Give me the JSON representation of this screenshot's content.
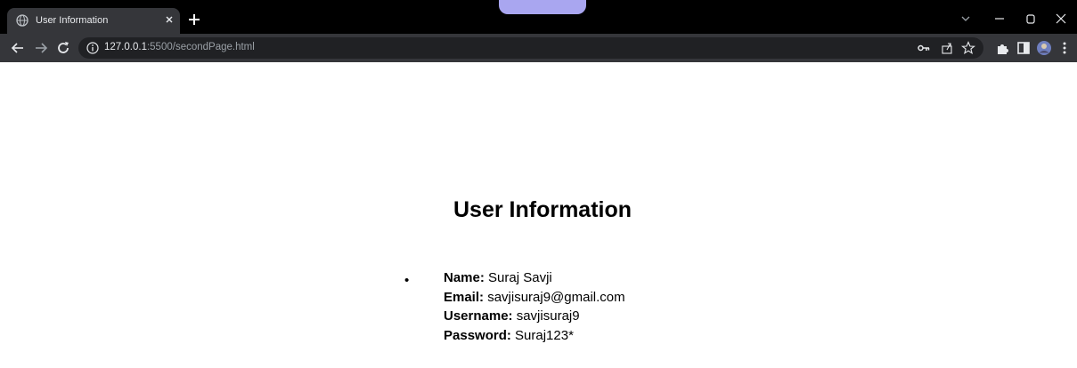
{
  "browser": {
    "tab": {
      "title": "User Information"
    },
    "address_bar": {
      "host": "127.0.0.1",
      "rest": ":5500/secondPage.html"
    },
    "accent_color": "#a9a6f0"
  },
  "page": {
    "title": "User Information",
    "user": [
      {
        "label": "Name:",
        "value": "Suraj Savji"
      },
      {
        "label": "Email:",
        "value": "savjisuraj9@gmail.com"
      },
      {
        "label": "Username:",
        "value": "savjisuraj9"
      },
      {
        "label": "Password:",
        "value": "Suraj123*"
      }
    ]
  }
}
